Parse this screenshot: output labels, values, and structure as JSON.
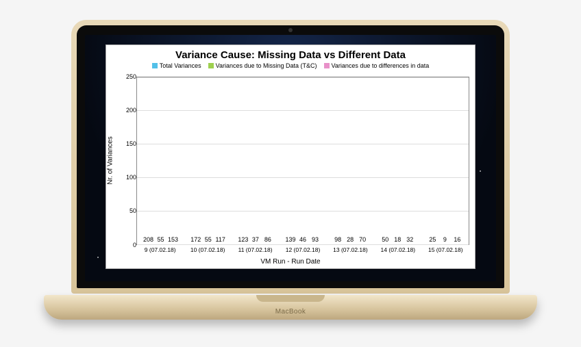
{
  "device_brand": "MacBook",
  "chart_data": {
    "type": "bar",
    "title": "Variance Cause: Missing Data vs Different Data",
    "xlabel": "VM Run - Run Date",
    "ylabel": "Nr. of Variances",
    "ylim": [
      0,
      250
    ],
    "yticks": [
      0,
      50,
      100,
      150,
      200,
      250
    ],
    "categories": [
      "9 (07.02.18)",
      "10 (07.02.18)",
      "11 (07.02.18)",
      "12 (07.02.18)",
      "13 (07.02.18)",
      "14 (07.02.18)",
      "15 (07.02.18)"
    ],
    "series": [
      {
        "name": "Total Variances",
        "color": "#53c0e8",
        "values": [
          208,
          172,
          123,
          139,
          98,
          50,
          25
        ]
      },
      {
        "name": "Variances due to Missing Data (T&C)",
        "color": "#9ed04f",
        "values": [
          55,
          55,
          37,
          46,
          28,
          18,
          9
        ]
      },
      {
        "name": "Variances due to differences in data",
        "color": "#e891c9",
        "values": [
          153,
          117,
          86,
          93,
          70,
          32,
          16
        ]
      }
    ]
  }
}
